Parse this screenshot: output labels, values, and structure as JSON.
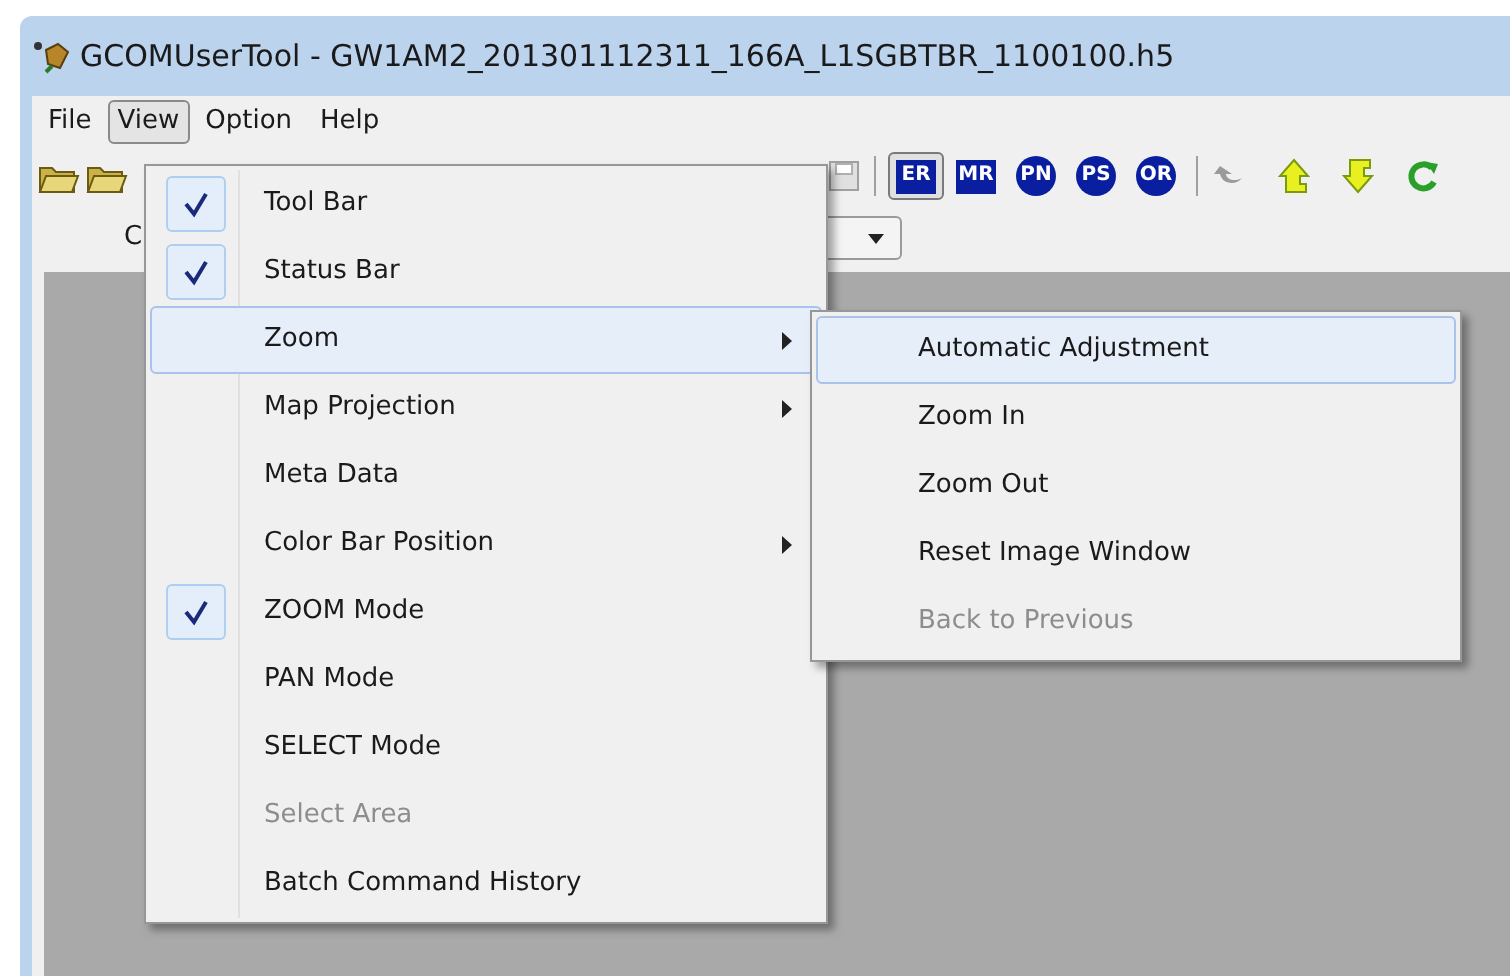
{
  "window": {
    "title": "GCOMUserTool - GW1AM2_201301112311_166A_L1SGBTBR_1100100.h5"
  },
  "menu_bar": [
    {
      "label": "File",
      "selected": false
    },
    {
      "label": "View",
      "selected": true
    },
    {
      "label": "Option",
      "selected": false
    },
    {
      "label": "Help",
      "selected": false
    }
  ],
  "mode_buttons": [
    {
      "label": "ER",
      "kind": "square",
      "selected": true
    },
    {
      "label": "MR",
      "kind": "square",
      "selected": false
    },
    {
      "label": "PN",
      "kind": "round",
      "selected": false
    },
    {
      "label": "PS",
      "kind": "round",
      "selected": false
    },
    {
      "label": "OR",
      "kind": "round",
      "selected": false
    }
  ],
  "second_row": {
    "label": "C"
  },
  "view_menu": [
    {
      "label": "Tool Bar",
      "checked": true,
      "selected": false,
      "disabled": false,
      "submenu": false
    },
    {
      "label": "Status Bar",
      "checked": true,
      "selected": false,
      "disabled": false,
      "submenu": false
    },
    {
      "label": "Zoom",
      "checked": false,
      "selected": true,
      "disabled": false,
      "submenu": true
    },
    {
      "label": "Map Projection",
      "checked": false,
      "selected": false,
      "disabled": false,
      "submenu": true
    },
    {
      "label": "Meta Data",
      "checked": false,
      "selected": false,
      "disabled": false,
      "submenu": false
    },
    {
      "label": "Color Bar Position",
      "checked": false,
      "selected": false,
      "disabled": false,
      "submenu": true
    },
    {
      "label": "ZOOM Mode",
      "checked": true,
      "selected": false,
      "disabled": false,
      "submenu": false
    },
    {
      "label": "PAN Mode",
      "checked": false,
      "selected": false,
      "disabled": false,
      "submenu": false
    },
    {
      "label": "SELECT Mode",
      "checked": false,
      "selected": false,
      "disabled": false,
      "submenu": false
    },
    {
      "label": "Select Area",
      "checked": false,
      "selected": false,
      "disabled": true,
      "submenu": false
    },
    {
      "label": "Batch Command History",
      "checked": false,
      "selected": false,
      "disabled": false,
      "submenu": false
    }
  ],
  "zoom_submenu": [
    {
      "label": "Automatic Adjustment",
      "selected": true,
      "disabled": false
    },
    {
      "label": "Zoom In",
      "selected": false,
      "disabled": false
    },
    {
      "label": "Zoom Out",
      "selected": false,
      "disabled": false
    },
    {
      "label": "Reset Image Window",
      "selected": false,
      "disabled": false
    },
    {
      "label": "Back to Previous",
      "selected": false,
      "disabled": true
    }
  ]
}
